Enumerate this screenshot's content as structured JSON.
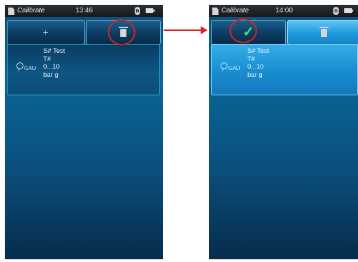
{
  "left_screen": {
    "status": {
      "app_title": "Calibrate",
      "time": "13:46",
      "bluetooth_glyph": "ʙ"
    },
    "toolbar": {
      "add_label": "+",
      "delete_icon": "trash-icon"
    },
    "item": {
      "serial": "S# Test",
      "tag": "T#",
      "range": "0...10",
      "unit": "bar g",
      "type": "GAU",
      "selected": false
    }
  },
  "right_screen": {
    "status": {
      "app_title": "Calibrate",
      "time": "14:00",
      "bluetooth_glyph": "ʙ"
    },
    "toolbar": {
      "confirm_label": "✓",
      "delete_icon": "trash-icon"
    },
    "item": {
      "serial": "S# Test",
      "tag": "T#",
      "range": "0...10",
      "unit": "bar g",
      "type": "GAU",
      "selected": true
    }
  },
  "colors": {
    "callout": "#e22020",
    "accent": "#1f9be0",
    "check": "#55e060"
  }
}
